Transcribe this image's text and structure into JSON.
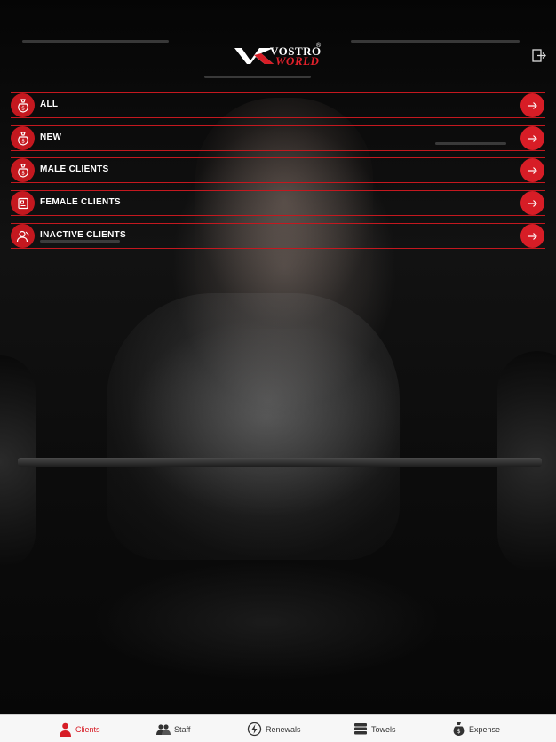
{
  "brand": {
    "line1": "VOSTRO",
    "registered": "®",
    "line2": "WORLD",
    "accent_color": "#d71d26"
  },
  "header": {
    "logout_icon": "logout-icon"
  },
  "menu": {
    "items": [
      {
        "label": "ALL",
        "icon": "money-bag-icon"
      },
      {
        "label": "NEW",
        "icon": "money-bag-icon"
      },
      {
        "label": "MALE CLIENTS",
        "icon": "money-bag-icon"
      },
      {
        "label": "FEMALE CLIENTS",
        "icon": "id-card-icon"
      },
      {
        "label": "INACTIVE CLIENTS",
        "icon": "user-off-icon"
      }
    ],
    "arrow_icon": "arrow-right-icon"
  },
  "tabbar": {
    "active": "Clients",
    "tabs": [
      {
        "label": "Clients",
        "icon": "client-icon"
      },
      {
        "label": "Staff",
        "icon": "staff-icon"
      },
      {
        "label": "Renewals",
        "icon": "renewal-icon"
      },
      {
        "label": "Towels",
        "icon": "towel-icon"
      },
      {
        "label": "Expense",
        "icon": "money-bag-icon"
      }
    ]
  }
}
